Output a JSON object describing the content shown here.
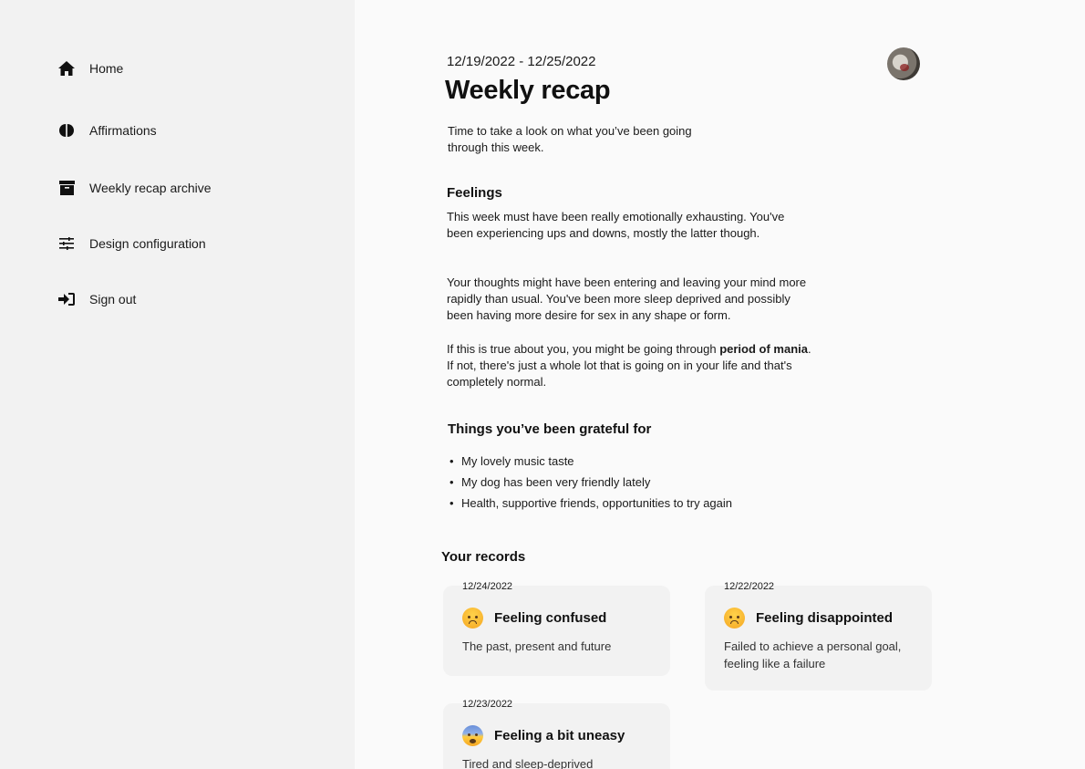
{
  "sidebar": {
    "items": [
      {
        "label": "Home",
        "icon": "home-icon"
      },
      {
        "label": "Affirmations",
        "icon": "brain-icon"
      },
      {
        "label": "Weekly recap archive",
        "icon": "archive-icon"
      },
      {
        "label": "Design configuration",
        "icon": "sliders-icon"
      },
      {
        "label": "Sign out",
        "icon": "sign-out-icon"
      }
    ]
  },
  "header": {
    "date_range": "12/19/2022 - 12/25/2022",
    "title": "Weekly recap",
    "intro": "Time to take a look on what you’ve been going through this week."
  },
  "feelings": {
    "heading": "Feelings",
    "p1": "This week must have been really emotionally exhausting. You've been experiencing ups and downs, mostly the latter though.",
    "p2": "Your thoughts might have been entering and leaving your mind more rapidly than usual. You've been more sleep deprived and possibly been having more desire for sex in any shape or form.",
    "p3_before": "If this is true about you, you might be going through ",
    "p3_bold": "period of mania",
    "p3_after": ". If not, there's just a whole lot that is going on in your life and that's completely normal."
  },
  "grateful": {
    "heading": "Things you’ve been grateful for",
    "items": [
      "My lovely music taste",
      "My dog has been very friendly lately",
      "Health, supportive friends, opportunities to try again"
    ]
  },
  "records": {
    "heading": "Your records",
    "items": [
      {
        "date": "12/24/2022",
        "title": "Feeling confused",
        "desc": "The past, present and future",
        "emoji": "confused-emoji-icon"
      },
      {
        "date": "12/22/2022",
        "title": "Feeling disappointed",
        "desc": "Failed to achieve a personal goal, feeling like a failure",
        "emoji": "disappointed-emoji-icon"
      },
      {
        "date": "12/23/2022",
        "title": "Feeling a bit uneasy",
        "desc": "Tired and sleep-deprived",
        "emoji": "anxious-emoji-icon"
      }
    ]
  }
}
